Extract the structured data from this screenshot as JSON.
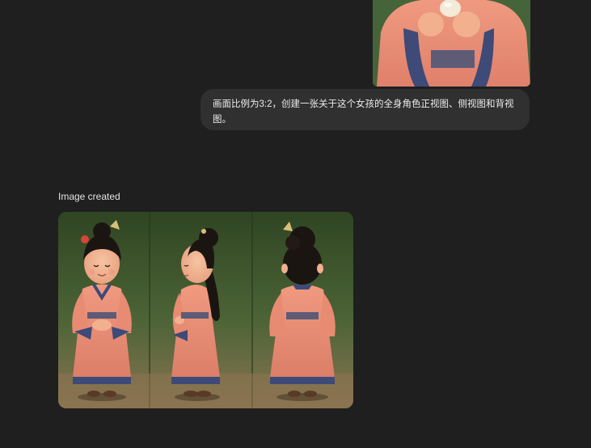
{
  "conversation": {
    "user_message": {
      "image_alt_semantic": "girl-character-reference-photo",
      "text": "画面比例为3:2，创建一张关于这个女孩的全身角色正视图、侧视图和背视图。"
    },
    "assistant_message": {
      "status_label": "Image created",
      "image_semantic": "girl-front-side-back-character-sheet"
    }
  },
  "colors": {
    "page_background": "#1f1f1f",
    "bubble_background": "#303030",
    "text_primary": "#ececec",
    "robe_coral": "#e58a72",
    "robe_trim_navy": "#3e4a78",
    "forest_green": "#3f5a34"
  }
}
